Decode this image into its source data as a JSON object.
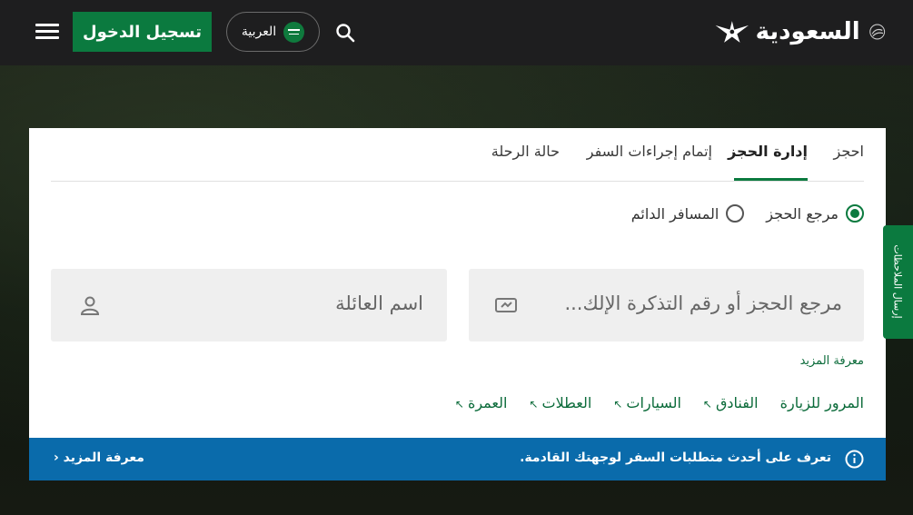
{
  "header": {
    "login_label": "تسجيل الدخول",
    "language_label": "العربية",
    "logo_text": "السعودية",
    "menu_icon": "hamburger-icon",
    "search_icon": "search-icon"
  },
  "tabs": [
    {
      "label": "احجز",
      "active": false
    },
    {
      "label": "إدارة الحجز",
      "active": true
    },
    {
      "label": "إتمام إجراءات السفر",
      "active": false
    },
    {
      "label": "حالة الرحلة",
      "active": false
    }
  ],
  "search_type": {
    "options": [
      {
        "label": "مرجع الحجز",
        "checked": true
      },
      {
        "label": "المسافر الدائم",
        "checked": false
      }
    ]
  },
  "form": {
    "booking_ref_placeholder": "مرجع الحجز أو رقم التذكرة الإلك...",
    "last_name_placeholder": "اسم العائلة"
  },
  "learn_more_small": "معرفة المزيد",
  "quick_links": [
    "المرور للزيارة",
    "الفنادق",
    "السيارات",
    "العطلات",
    "العمرة"
  ],
  "banner": {
    "message": "تعرف على أحدث متطلبات السفر لوجهتك القادمة.",
    "link_label": "معرفة المزيد"
  },
  "feedback_label": "إرسال الملاحظات",
  "colors": {
    "brand_green": "#0b7a3f",
    "banner_blue": "#0a6bab",
    "topbar": "#1e1e1f"
  }
}
